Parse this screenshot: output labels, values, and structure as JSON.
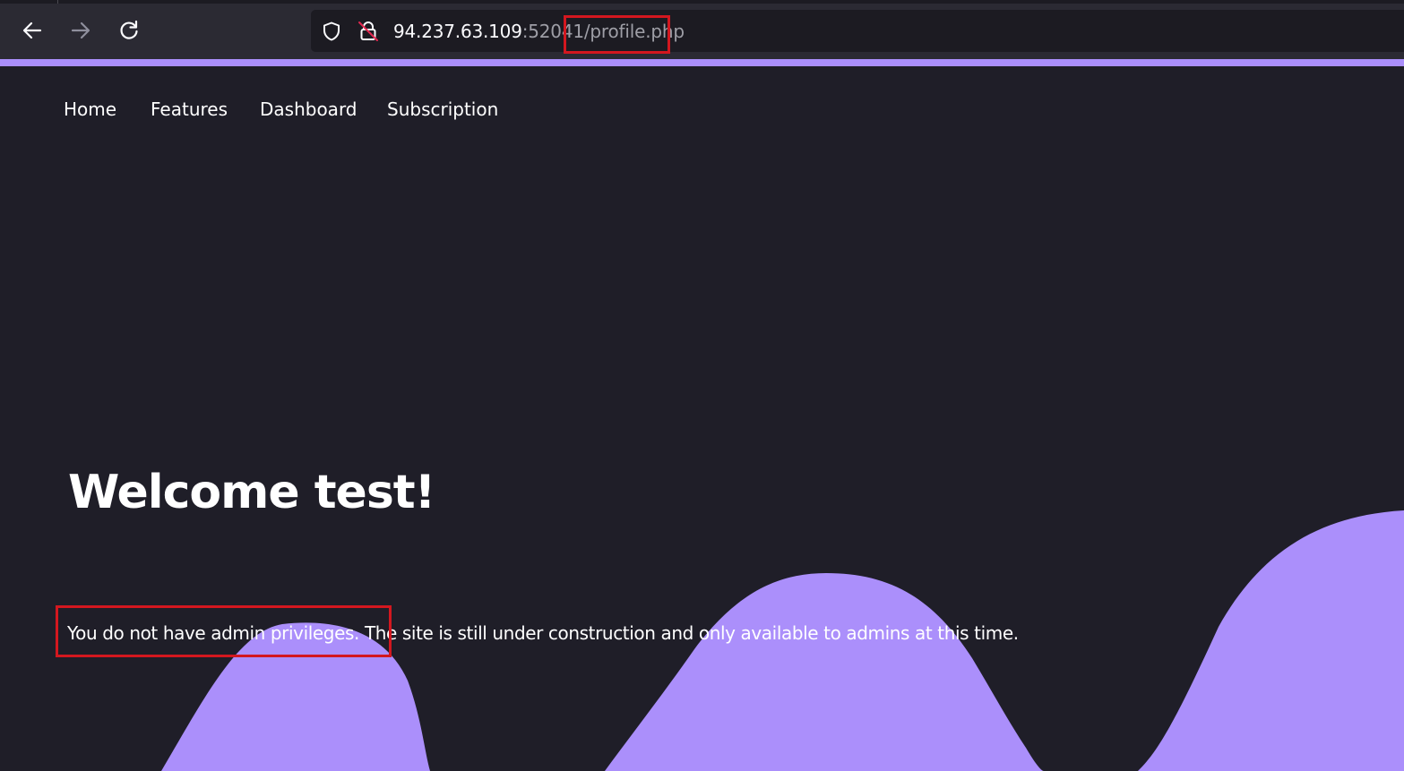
{
  "browser": {
    "url_host": "94.237.63.109",
    "url_port_path": ":52041/",
    "url_file": "profile.php"
  },
  "nav": {
    "items": [
      "Home",
      "Features",
      "Dashboard",
      "Subscription"
    ]
  },
  "hero": {
    "title": "Welcome test!",
    "message": "You do not have admin privileges. The site is still under construction and only available to admins at this time."
  },
  "colors": {
    "background": "#1f1e28",
    "accent": "#ab8ffb",
    "highlight": "#d3171f"
  }
}
